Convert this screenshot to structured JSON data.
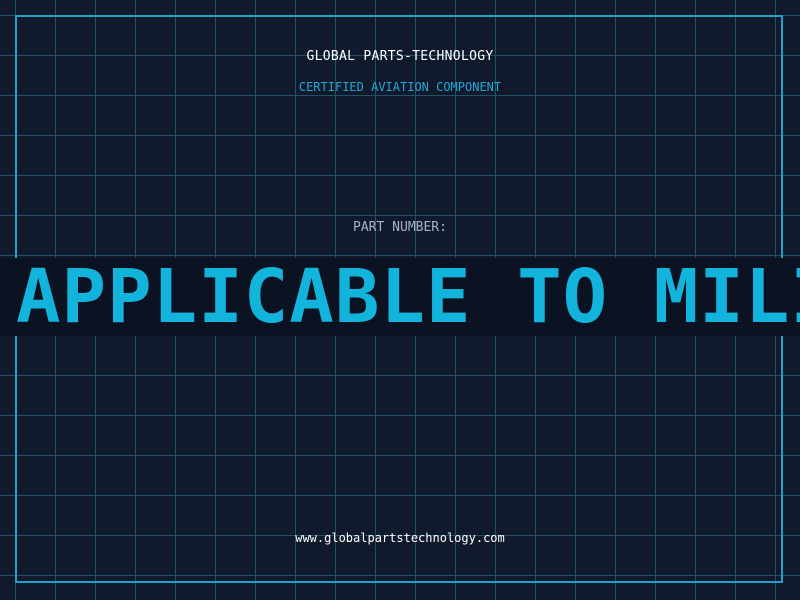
{
  "header": {
    "brand": "GLOBAL PARTS-TECHNOLOGY",
    "subtitle": "CERTIFIED AVIATION COMPONENT"
  },
  "part": {
    "label": "PART NUMBER:",
    "value": "APPLICABLE TO MILI"
  },
  "footer": {
    "website": "www.globalpartstechnology.com"
  },
  "colors": {
    "background": "#111a2c",
    "grid": "#1e5266",
    "accent": "#1fa3c9",
    "banner_text": "#12b4dc"
  }
}
